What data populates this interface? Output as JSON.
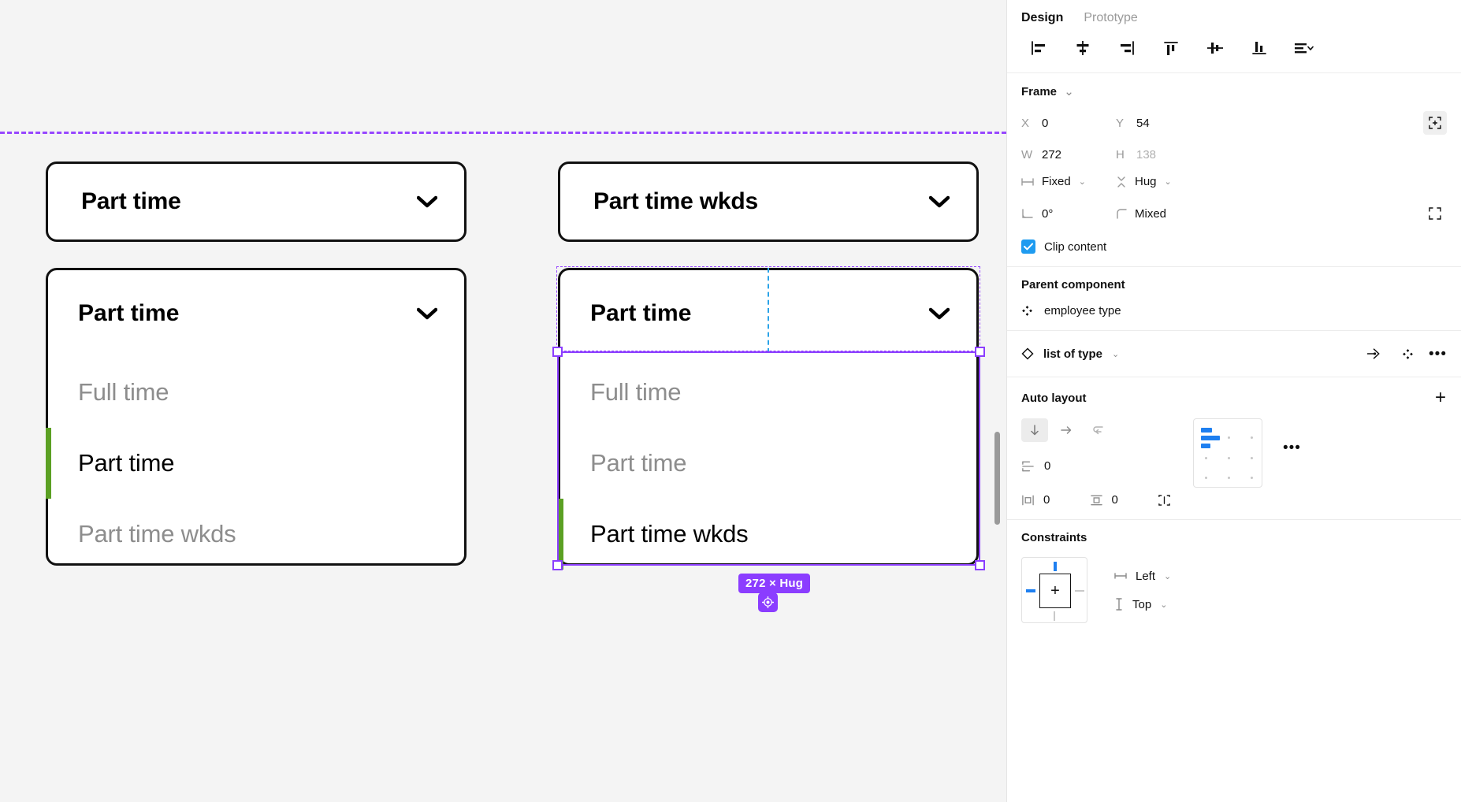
{
  "canvas": {
    "frame_guide_label": "",
    "components": [
      {
        "id": "left-closed",
        "type": "dropdown-closed",
        "value": "Part time",
        "icon": "chevron-down-icon"
      },
      {
        "id": "right-closed",
        "type": "dropdown-closed",
        "value": "Part time wkds",
        "icon": "chevron-down-icon"
      }
    ],
    "left_open_dropdown": {
      "header_value": "Part time",
      "icon": "chevron-down-icon",
      "options": [
        {
          "label": "Full time",
          "state": "dim"
        },
        {
          "label": "Part time",
          "state": "selected"
        },
        {
          "label": "Part time wkds",
          "state": "dim"
        }
      ]
    },
    "right_open_dropdown": {
      "header_value": "Part time",
      "icon": "chevron-down-icon",
      "options": [
        {
          "label": "Full time",
          "state": "dim"
        },
        {
          "label": "Part time",
          "state": "dim"
        },
        {
          "label": "Part time wkds",
          "state": "selected"
        }
      ]
    },
    "selection": {
      "size_badge": "272 × Hug",
      "handle_color": "#8b3dff",
      "outline_color": "#8b3dff",
      "guide_color": "#2ba3e8",
      "selected_item_marker_color": "#5ba023"
    },
    "annotation": {
      "type": "red-arrow",
      "color": "#e02020",
      "points_at": "Clip content"
    }
  },
  "panel": {
    "tabs": [
      {
        "label": "Design",
        "active": true
      },
      {
        "label": "Prototype",
        "active": false
      }
    ],
    "align_tools": [
      {
        "name": "align-left-icon",
        "title": "Align left"
      },
      {
        "name": "align-horizontal-centers-icon",
        "title": "Align horizontal centers"
      },
      {
        "name": "align-right-icon",
        "title": "Align right"
      },
      {
        "name": "align-top-icon",
        "title": "Align top"
      },
      {
        "name": "align-vertical-centers-icon",
        "title": "Align vertical centers"
      },
      {
        "name": "align-bottom-icon",
        "title": "Align bottom"
      },
      {
        "name": "distribute-icon",
        "title": "Tidy up"
      }
    ],
    "frame": {
      "title": "Frame",
      "x_key": "X",
      "x_value": "0",
      "y_key": "Y",
      "y_value": "54",
      "w_key": "W",
      "w_value": "272",
      "h_key": "H",
      "h_value": "138",
      "resize_w": "Fixed",
      "resize_h": "Hug",
      "rotation": "0°",
      "corner_radius": "Mixed",
      "clip_content_label": "Clip content",
      "clip_content_checked": true
    },
    "parent_component": {
      "title": "Parent component",
      "name": "employee type",
      "icon": "component-diamond-icon"
    },
    "instance": {
      "name": "list of type",
      "icon": "instance-diamond-icon",
      "swap_icon": "swap-instance-icon",
      "main_component_icon": "component-diamond-icon",
      "more_icon": "more-options-icon"
    },
    "auto_layout": {
      "title": "Auto layout",
      "add_icon": "plus-icon",
      "direction": "vertical",
      "direction_icons": [
        "arrow-down-icon",
        "arrow-right-icon",
        "wrap-icon"
      ],
      "gap_label_icon": "gap-between-icon",
      "gap_value": "0",
      "horizontal_padding_icon": "horizontal-padding-icon",
      "horizontal_padding": "0",
      "vertical_padding_icon": "vertical-padding-icon",
      "vertical_padding": "0",
      "individual_padding_icon": "individual-padding-icon",
      "alignment_pad_selected": "top-left",
      "more_icon": "more-options-icon"
    },
    "constraints": {
      "title": "Constraints",
      "horizontal_icon": "horizontal-constraint-icon",
      "horizontal": "Left",
      "vertical_icon": "vertical-constraint-icon",
      "vertical": "Top"
    }
  }
}
